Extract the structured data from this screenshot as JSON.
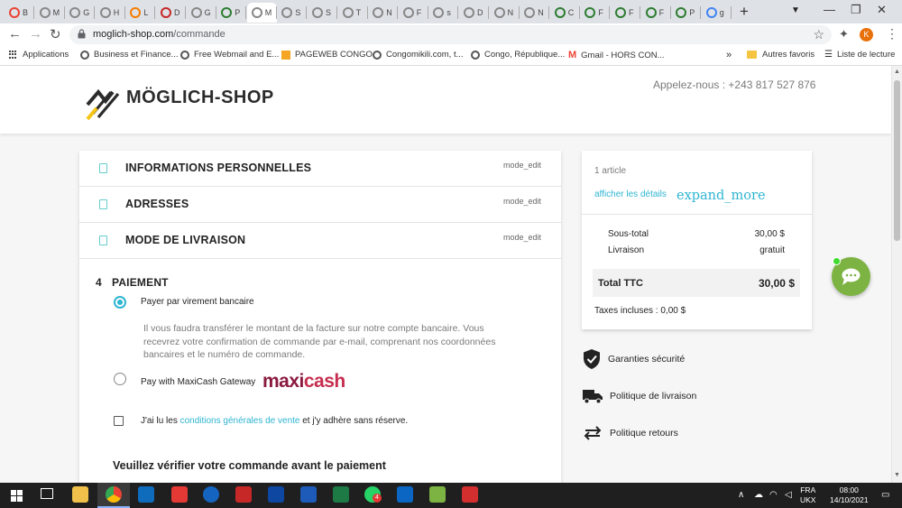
{
  "browser": {
    "tabs": [
      {
        "letter": "B",
        "color": "#ea4335"
      },
      {
        "letter": "M",
        "color": "#888888"
      },
      {
        "letter": "G",
        "color": "#888888"
      },
      {
        "letter": "H",
        "color": "#888888"
      },
      {
        "letter": "L",
        "color": "#f57c00"
      },
      {
        "letter": "D",
        "color": "#c62828"
      },
      {
        "letter": "G",
        "color": "#888888"
      },
      {
        "letter": "P",
        "color": "#2e7d32"
      },
      {
        "letter": "M",
        "color": "#888888",
        "active": true
      },
      {
        "letter": "S",
        "color": "#888888"
      },
      {
        "letter": "S",
        "color": "#888888"
      },
      {
        "letter": "T",
        "color": "#888888"
      },
      {
        "letter": "N",
        "color": "#888888"
      },
      {
        "letter": "F",
        "color": "#888888"
      },
      {
        "letter": "s",
        "color": "#888888"
      },
      {
        "letter": "D",
        "color": "#888888"
      },
      {
        "letter": "N",
        "color": "#888888"
      },
      {
        "letter": "N",
        "color": "#888888"
      },
      {
        "letter": "C",
        "color": "#2e7d32"
      },
      {
        "letter": "F",
        "color": "#2e7d32"
      },
      {
        "letter": "F",
        "color": "#2e7d32"
      },
      {
        "letter": "F",
        "color": "#2e7d32"
      },
      {
        "letter": "P",
        "color": "#2e7d32"
      },
      {
        "letter": "g",
        "color": "#4285f4"
      }
    ],
    "new_tab": "+",
    "url_domain": "moglich-shop.com",
    "url_path": "/commande",
    "profile_initial": "K",
    "bookmarks": [
      {
        "label": "Applications",
        "kind": "apps"
      },
      {
        "label": "Business et Finance...",
        "kind": "site"
      },
      {
        "label": "Free Webmail and E...",
        "kind": "site"
      },
      {
        "label": "PAGEWEB CONGO",
        "kind": "orange"
      },
      {
        "label": "Congomikili.com, t...",
        "kind": "site"
      },
      {
        "label": "Congo, République...",
        "kind": "site"
      },
      {
        "label": "Gmail - HORS CON...",
        "kind": "gmail"
      }
    ],
    "bookmarks_more": "»",
    "other_favorites": "Autres favoris",
    "reading_list": "Liste de lecture"
  },
  "site": {
    "brand": "MÖGLICH-SHOP",
    "phone": "Appelez-nous : +243 817 527 876"
  },
  "checkout": {
    "steps": [
      {
        "title": "INFORMATIONS PERSONNELLES",
        "edit": "mode_edit"
      },
      {
        "title": "ADRESSES",
        "edit": "mode_edit"
      },
      {
        "title": "MODE DE LIVRAISON",
        "edit": "mode_edit"
      }
    ],
    "payment_number": "4",
    "payment_title": "PAIEMENT",
    "option_bank": "Payer par virement bancaire",
    "bank_info": "Il vous faudra transférer le montant de la facture sur notre compte bancaire. Vous recevrez votre confirmation de commande par e-mail, comprenant nos coordonnées bancaires et le numéro de commande.",
    "option_maxicash": "Pay with MaxiCash Gateway",
    "maxicash_logo_a": "maxi",
    "maxicash_logo_b": "cash",
    "terms_before": "J'ai lu les ",
    "terms_link": "conditions générales de vente",
    "terms_after": " et j'y adhère sans réserve.",
    "verify": "Veuillez vérifier votre commande avant le paiement"
  },
  "summary": {
    "item_count": "1 article",
    "show_details": "afficher les détails",
    "expand": "expand_more",
    "subtotal_label": "Sous-total",
    "subtotal_value": "30,00 $",
    "shipping_label": "Livraison",
    "shipping_value": "gratuit",
    "total_label": "Total TTC",
    "total_value": "30,00 $",
    "taxes": "Taxes incluses : 0,00 $"
  },
  "reassurance": [
    {
      "label": "Garanties sécurité",
      "icon": "shield-icon"
    },
    {
      "label": "Politique de livraison",
      "icon": "truck-icon"
    },
    {
      "label": "Politique retours",
      "icon": "swap-arrows-icon"
    }
  ],
  "taskbar": {
    "lang_top": "FRA",
    "lang_bottom": "UKX",
    "time": "08:00",
    "date": "14/10/2021",
    "whatsapp_badge": "4"
  },
  "colors": {
    "accent": "#2fb5d2",
    "chat": "#7cb342",
    "maxicash": "#8b1a3f"
  }
}
